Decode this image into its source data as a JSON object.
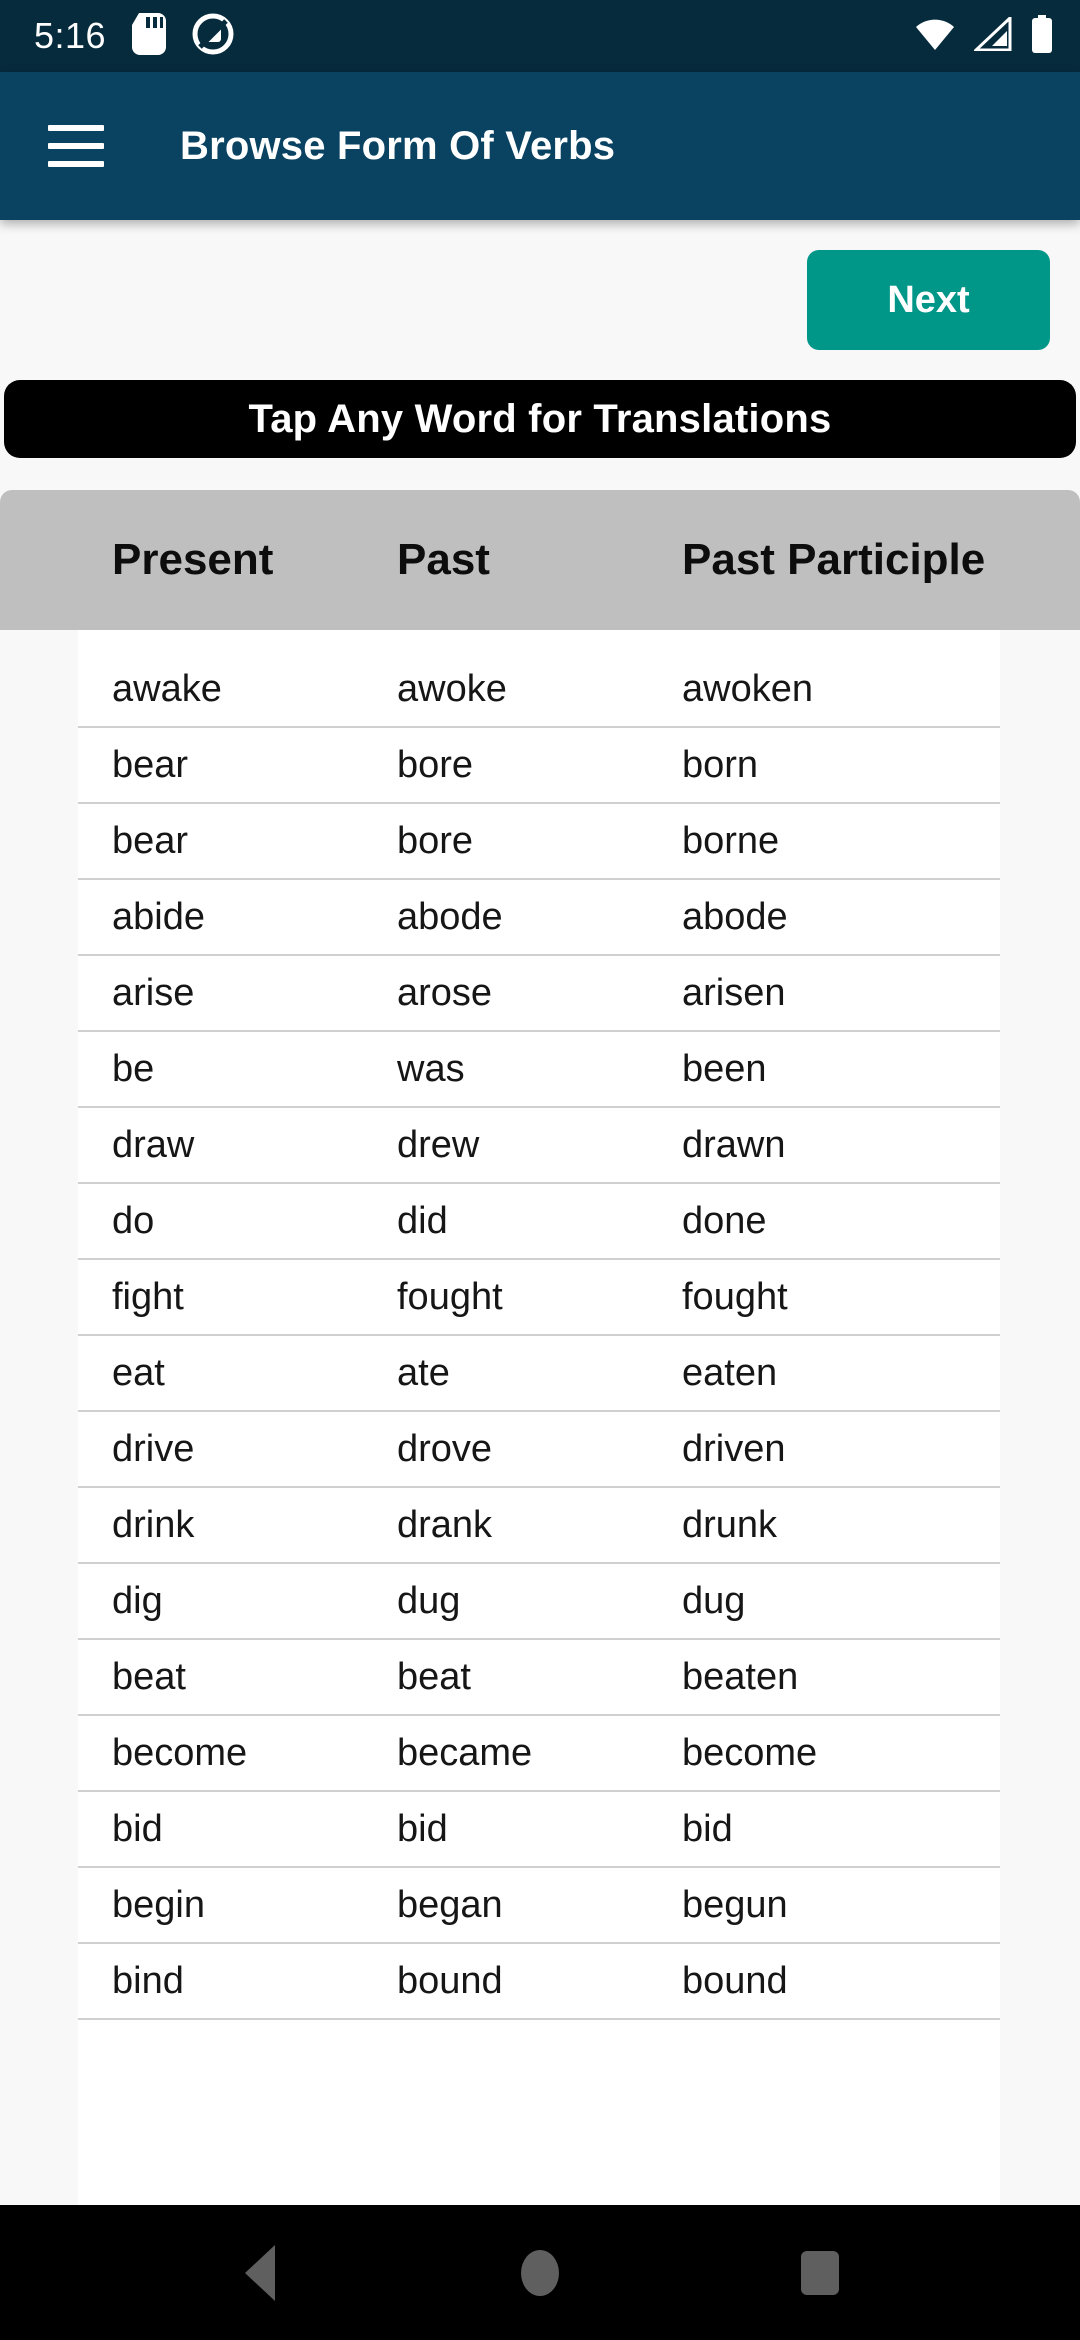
{
  "statusbar": {
    "time": "5:16",
    "left_icons": [
      "sd-card-icon",
      "data-saver-icon"
    ],
    "right_icons": [
      "wifi-icon",
      "cellular-signal-icon",
      "battery-icon"
    ]
  },
  "appbar": {
    "menu_icon": "hamburger-menu-icon",
    "title": "Browse Form Of Verbs",
    "background": "#0a4361"
  },
  "toolbar": {
    "next_label": "Next",
    "next_color": "#009688"
  },
  "banner": {
    "text": "Tap Any Word for Translations",
    "background": "#000000"
  },
  "table": {
    "headers": [
      "Present",
      "Past",
      "Past Participle"
    ],
    "header_background": "#bfbfbf",
    "rows": [
      {
        "present": "awake",
        "past": "awoke",
        "participle": "awoken"
      },
      {
        "present": "bear",
        "past": "bore",
        "participle": "born"
      },
      {
        "present": "bear",
        "past": "bore",
        "participle": "borne"
      },
      {
        "present": "abide",
        "past": "abode",
        "participle": "abode"
      },
      {
        "present": "arise",
        "past": "arose",
        "participle": "arisen"
      },
      {
        "present": "be",
        "past": "was",
        "participle": "been"
      },
      {
        "present": "draw",
        "past": "drew",
        "participle": "drawn"
      },
      {
        "present": "do",
        "past": "did",
        "participle": "done"
      },
      {
        "present": "fight",
        "past": "fought",
        "participle": "fought"
      },
      {
        "present": "eat",
        "past": "ate",
        "participle": "eaten"
      },
      {
        "present": "drive",
        "past": "drove",
        "participle": "driven"
      },
      {
        "present": "drink",
        "past": "drank",
        "participle": "drunk"
      },
      {
        "present": "dig",
        "past": "dug",
        "participle": "dug"
      },
      {
        "present": "beat",
        "past": "beat",
        "participle": "beaten"
      },
      {
        "present": "become",
        "past": "became",
        "participle": "become"
      },
      {
        "present": "bid",
        "past": "bid",
        "participle": "bid"
      },
      {
        "present": "begin",
        "past": "began",
        "participle": "begun"
      },
      {
        "present": "bind",
        "past": "bound",
        "participle": "bound"
      }
    ]
  },
  "navbar": {
    "back": "back-triangle-icon",
    "home": "home-circle-icon",
    "recents": "recents-square-icon"
  }
}
